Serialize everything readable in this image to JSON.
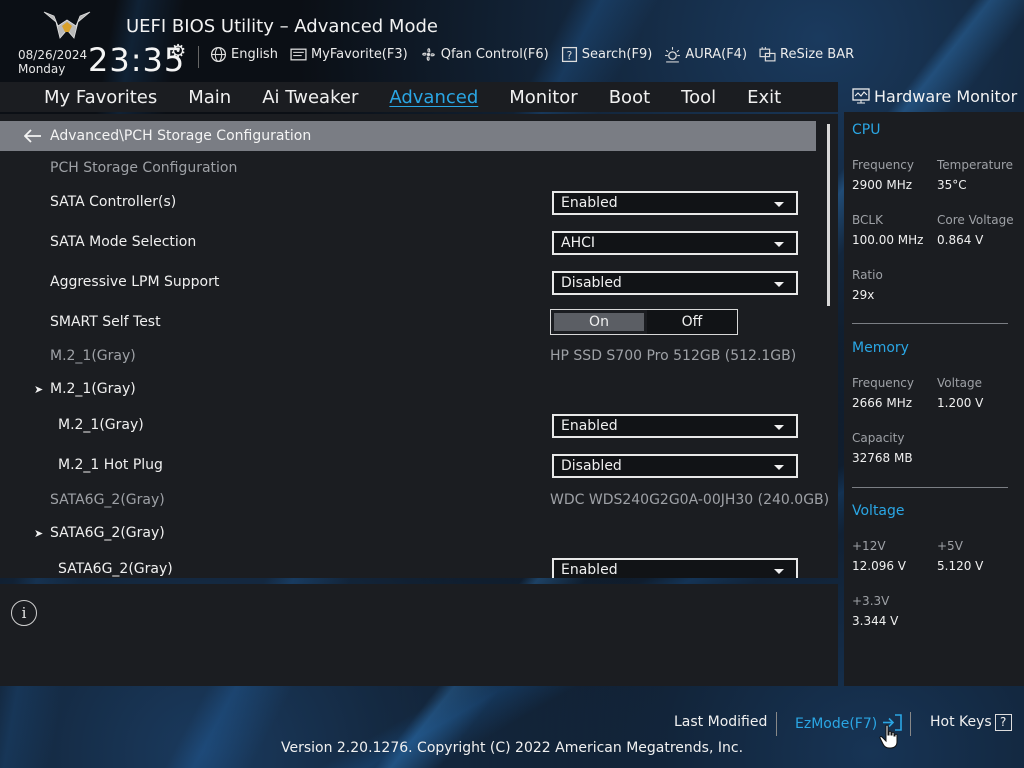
{
  "header": {
    "title": "UEFI BIOS Utility – Advanced Mode",
    "date": "08/26/2024",
    "day": "Monday",
    "time": "23:35",
    "toolbar": [
      {
        "icon": "globe-icon",
        "label": "English"
      },
      {
        "icon": "favorite-icon",
        "label": "MyFavorite(F3)"
      },
      {
        "icon": "fan-icon",
        "label": "Qfan Control(F6)"
      },
      {
        "icon": "search-icon",
        "label": "Search(F9)"
      },
      {
        "icon": "aura-icon",
        "label": "AURA(F4)"
      },
      {
        "icon": "resize-bar-icon",
        "label": "ReSize BAR"
      }
    ]
  },
  "menu": {
    "items": [
      "My Favorites",
      "Main",
      "Ai Tweaker",
      "Advanced",
      "Monitor",
      "Boot",
      "Tool",
      "Exit"
    ],
    "active": "Advanced"
  },
  "main": {
    "breadcrumb": "Advanced\\PCH Storage Configuration",
    "section_title": "PCH Storage Configuration",
    "rows": {
      "sata_controller": {
        "label": "SATA Controller(s)",
        "value": "Enabled"
      },
      "sata_mode": {
        "label": "SATA Mode Selection",
        "value": "AHCI"
      },
      "aggressive_lpm": {
        "label": "Aggressive LPM Support",
        "value": "Disabled"
      },
      "smart_self_test": {
        "label": "SMART Self Test",
        "on": "On",
        "off": "Off",
        "selected": "On"
      },
      "m2_1_info": {
        "label": "M.2_1(Gray)",
        "value": "HP SSD S700 Pro 512GB (512.1GB)"
      },
      "m2_1_group": {
        "label": "M.2_1(Gray)"
      },
      "m2_1_enable": {
        "label": "M.2_1(Gray)",
        "value": "Enabled"
      },
      "m2_1_hotplug": {
        "label": "M.2_1 Hot Plug",
        "value": "Disabled"
      },
      "sata6g_2_info": {
        "label": "SATA6G_2(Gray)",
        "value": "WDC WDS240G2G0A-00JH30 (240.0GB)"
      },
      "sata6g_2_group": {
        "label": "SATA6G_2(Gray)"
      },
      "sata6g_2_enable": {
        "label": "SATA6G_2(Gray)",
        "value": "Enabled"
      }
    }
  },
  "hardware_monitor": {
    "title": "Hardware Monitor",
    "cpu": {
      "title": "CPU",
      "frequency_label": "Frequency",
      "frequency": "2900 MHz",
      "temperature_label": "Temperature",
      "temperature": "35°C",
      "bclk_label": "BCLK",
      "bclk": "100.00 MHz",
      "core_voltage_label": "Core Voltage",
      "core_voltage": "0.864 V",
      "ratio_label": "Ratio",
      "ratio": "29x"
    },
    "memory": {
      "title": "Memory",
      "frequency_label": "Frequency",
      "frequency": "2666 MHz",
      "voltage_label": "Voltage",
      "voltage": "1.200 V",
      "capacity_label": "Capacity",
      "capacity": "32768 MB"
    },
    "voltage": {
      "title": "Voltage",
      "v12_label": "+12V",
      "v12": "12.096 V",
      "v5_label": "+5V",
      "v5": "5.120 V",
      "v33_label": "+3.3V",
      "v33": "3.344 V"
    }
  },
  "footer": {
    "last_modified": "Last Modified",
    "ezmode": "EzMode(F7)",
    "hot_keys": "Hot Keys",
    "hot_keys_key": "?",
    "copyright": "Version 2.20.1276. Copyright (C) 2022 American Megatrends, Inc."
  },
  "colors": {
    "accent": "#2aa6e4",
    "panel": "#1b1d21",
    "breadcrumb_bg": "#7a7d84"
  }
}
